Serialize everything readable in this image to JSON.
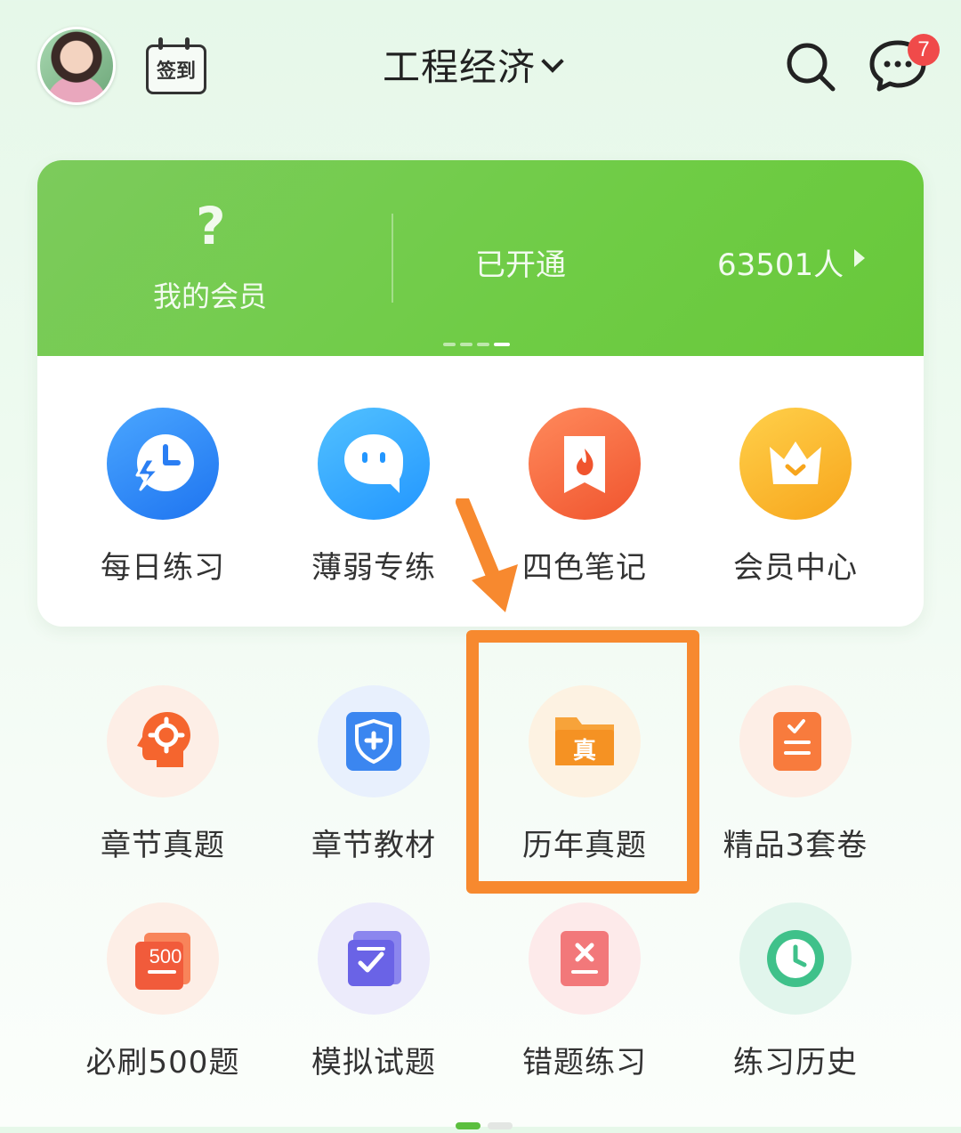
{
  "header": {
    "checkin_label": "签到",
    "title": "工程经济",
    "message_badge": "7"
  },
  "member_card": {
    "question_mark": "?",
    "my_member_label": "我的会员",
    "opened_label": "已开通",
    "member_count": "63501人"
  },
  "quick_actions": [
    {
      "label": "每日练习",
      "icon": "clock-lightning-icon"
    },
    {
      "label": "薄弱专练",
      "icon": "chat-bot-icon"
    },
    {
      "label": "四色笔记",
      "icon": "fire-note-icon"
    },
    {
      "label": "会员中心",
      "icon": "crown-icon"
    }
  ],
  "features_row1": [
    {
      "label": "章节真题",
      "icon": "head-gear-icon"
    },
    {
      "label": "章节教材",
      "icon": "shield-book-icon"
    },
    {
      "label": "历年真题",
      "icon": "folder-zhen-icon",
      "zhen": "真"
    },
    {
      "label": "精品3套卷",
      "icon": "checklist-icon"
    }
  ],
  "features_row2": [
    {
      "label": "必刷500题",
      "icon": "ticket-500-icon",
      "num": "500"
    },
    {
      "label": "模拟试题",
      "icon": "scroll-check-icon"
    },
    {
      "label": "错题练习",
      "icon": "wrong-card-icon"
    },
    {
      "label": "练习历史",
      "icon": "history-clock-icon"
    }
  ],
  "colors": {
    "accent_green": "#6cc840",
    "highlight_orange": "#f7892f",
    "badge_red": "#f04a4a"
  }
}
